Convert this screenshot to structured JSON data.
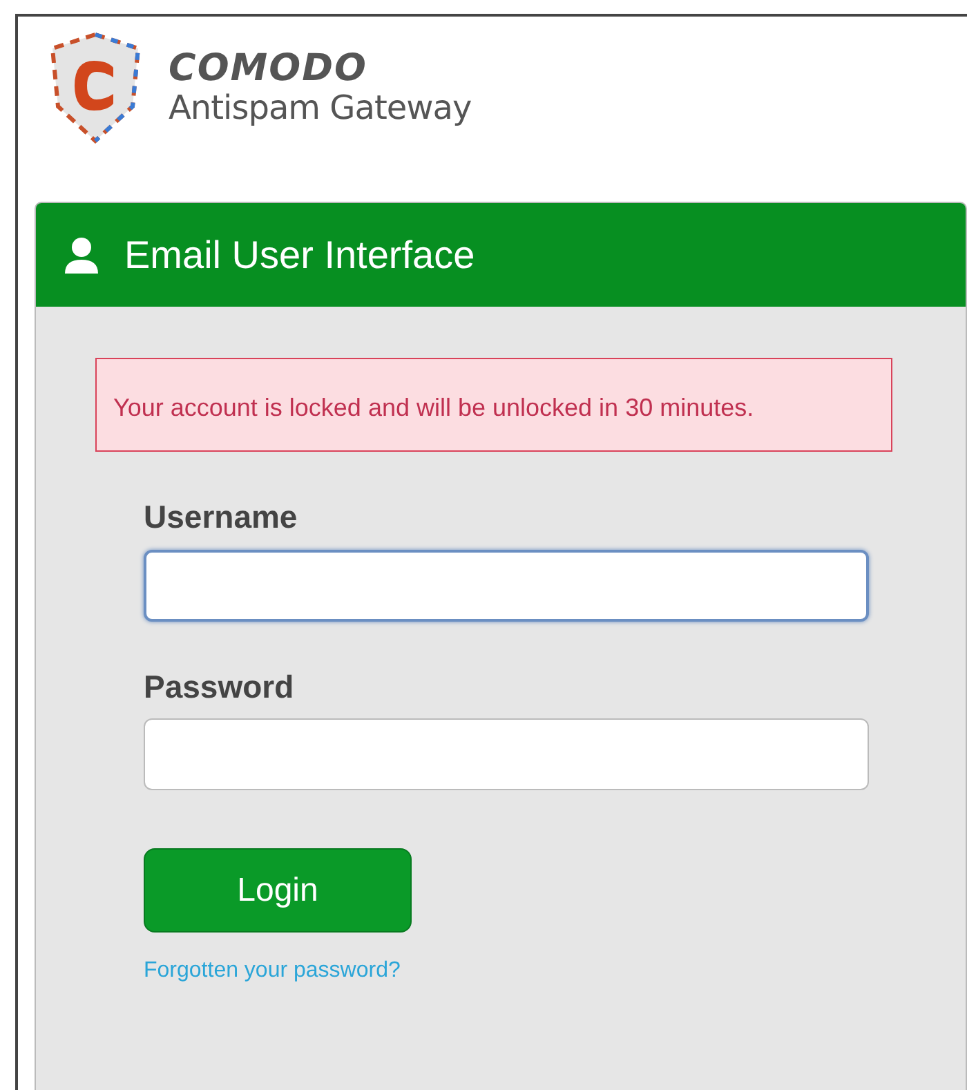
{
  "logo": {
    "brand": "COMODO",
    "product": "Antispam Gateway"
  },
  "panel": {
    "title": "Email User Interface",
    "alert": "Your account is locked and will be unlocked in 30 minutes.",
    "fields": [
      {
        "label": "Username",
        "focused": true
      },
      {
        "label": "Password",
        "focused": false
      }
    ],
    "button": "Login",
    "link": "Forgotten your password?"
  }
}
